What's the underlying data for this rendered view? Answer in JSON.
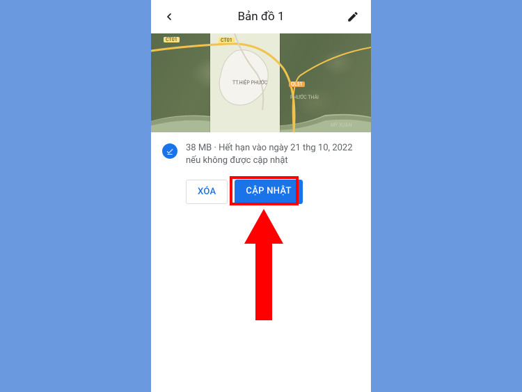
{
  "header": {
    "title": "Bản đồ 1"
  },
  "map": {
    "labels": {
      "town": "TT.HIỆP PHƯỚC",
      "phuocThai": "PHƯỚC THÁI",
      "myXuan": "MỸ XUÂN"
    },
    "roads": {
      "ct01a": "CT01",
      "ct01b": "CT01",
      "ql51": "QL51"
    }
  },
  "info": {
    "text": "38 MB · Hết hạn vào ngày 21 thg 10, 2022 nếu không được cập nhật"
  },
  "buttons": {
    "delete": "XÓA",
    "update": "CẬP NHẬT"
  }
}
